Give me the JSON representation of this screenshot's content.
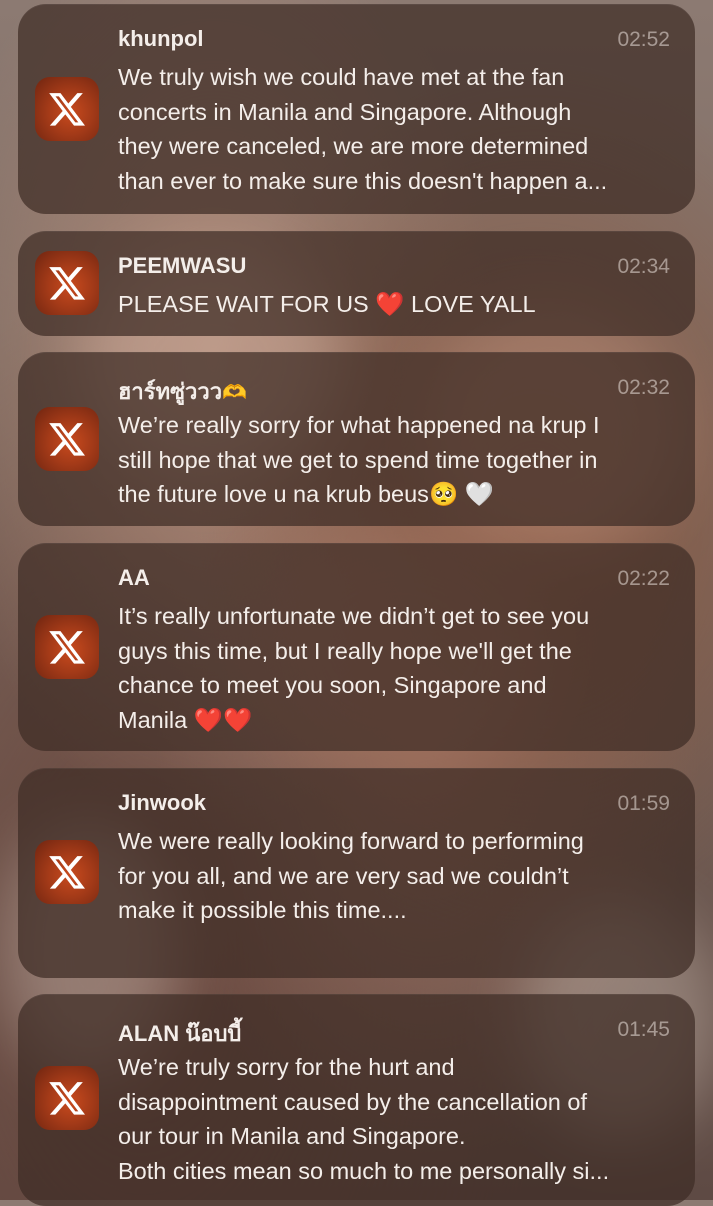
{
  "notifications": [
    {
      "sender": "khunpol",
      "time": "02:52",
      "lines": [
        "We truly wish we could have met at the fan",
        "concerts in Manila and Singapore. Although",
        "they were canceled, we are more determined",
        "than ever to make sure this doesn't happen a..."
      ]
    },
    {
      "sender": "PEEMWASU",
      "time": "02:34",
      "line_before": "PLEASE WAIT FOR US ",
      "emoji": "❤️",
      "line_after": " LOVE YALL"
    },
    {
      "sender": "ฮาร์ทซู่ววว",
      "sender_emoji": "🫶",
      "time": "02:32",
      "lines": [
        "We’re really sorry for what happened na krup I",
        "still hope that we get to spend time together in"
      ],
      "last_line": "the future love u na krub beus",
      "emoji_a": "🥺",
      "emoji_b": "🤍"
    },
    {
      "sender": "AA",
      "time": "02:22",
      "lines": [
        "It’s really unfortunate we didn’t get to see you",
        "guys this time, but I really hope we'll get the",
        "chance to meet you soon, Singapore and"
      ],
      "last_line": "Manila",
      "emoji_a": "❤️",
      "emoji_b": "❤️"
    },
    {
      "sender": "Jinwook",
      "time": "01:59",
      "lines": [
        "We were really looking forward to performing",
        "for you all, and we are very sad we couldn’t",
        "make it possible this time...."
      ]
    },
    {
      "sender": "ALAN น๊อบบี้",
      "time": "01:45",
      "lines": [
        "We’re truly sorry for the hurt and",
        "disappointment caused by the cancellation of",
        "our tour in Manila and Singapore.",
        "Both cities mean so much to me personally si..."
      ]
    }
  ],
  "app_icon": "x-app-icon",
  "colors": {
    "card_bg": "#3e2c26",
    "icon_bg": "#b2401a",
    "heart": "#e0202a"
  }
}
